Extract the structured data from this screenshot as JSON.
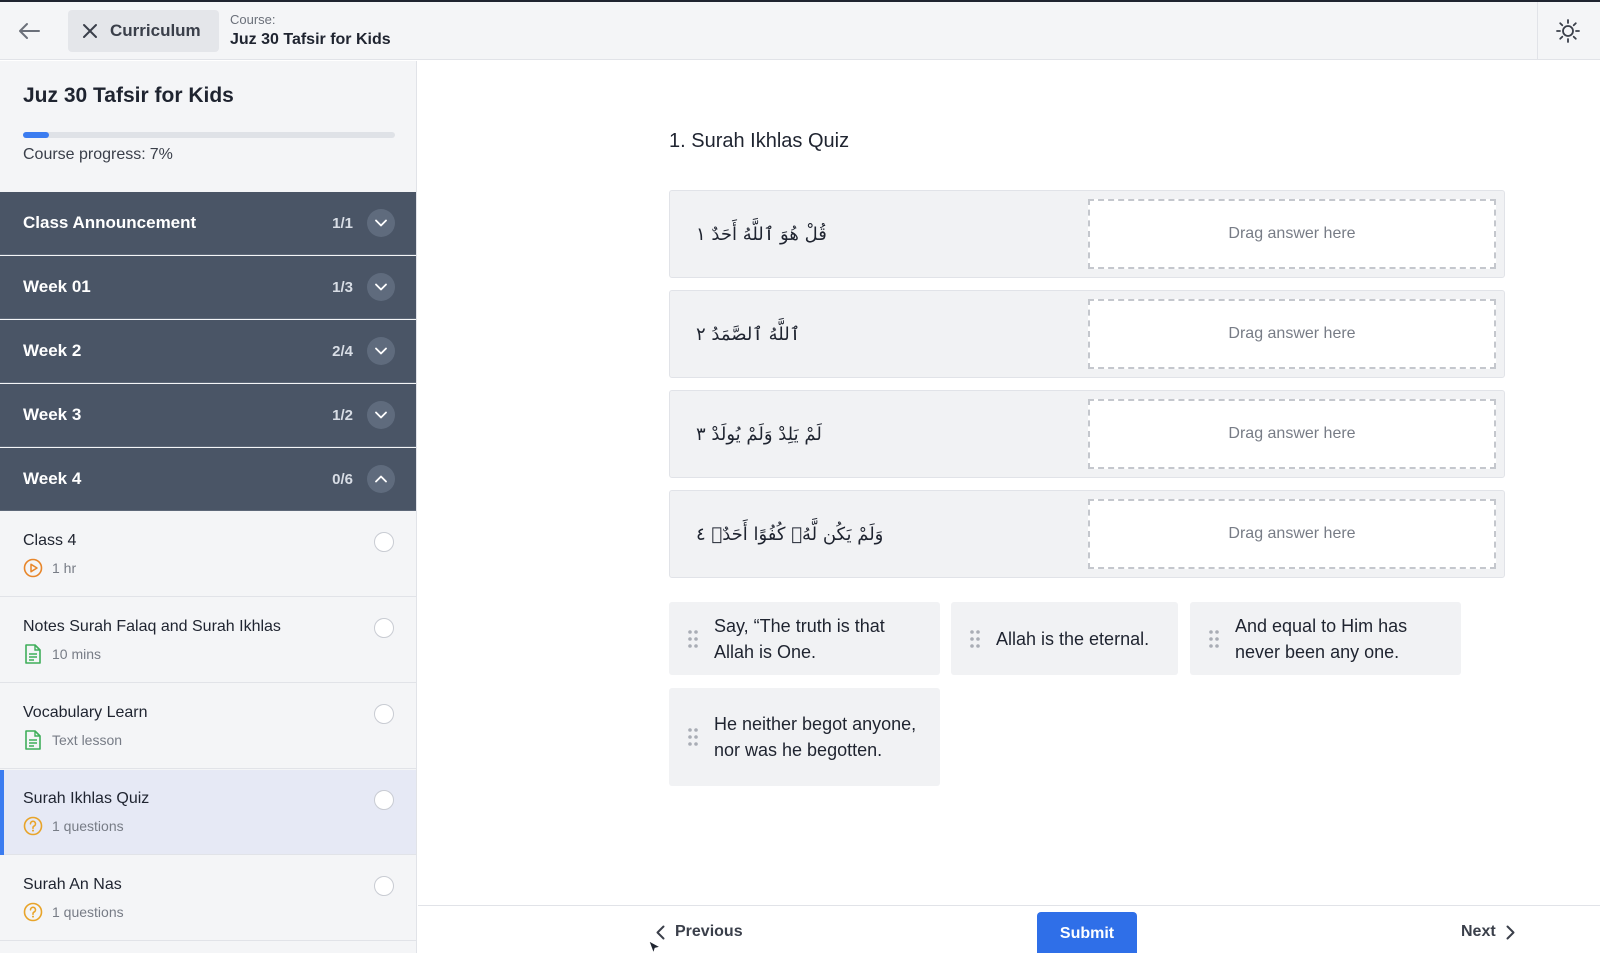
{
  "header": {
    "back_icon": "arrow-left-icon",
    "curriculum_label": "Curriculum",
    "course_label": "Course:",
    "course_name": "Juz 30 Tafsir for Kids",
    "theme_icon": "sun-icon"
  },
  "sidebar": {
    "title": "Juz 30 Tafsir for Kids",
    "progress_fraction": 0.07,
    "progress_label": "Course progress:",
    "progress_value": "7%",
    "sections": [
      {
        "title": "Class Announcement",
        "count": "1/1",
        "expanded": false
      },
      {
        "title": "Week 01",
        "count": "1/3",
        "expanded": false
      },
      {
        "title": "Week 2",
        "count": "2/4",
        "expanded": false
      },
      {
        "title": "Week 3",
        "count": "1/2",
        "expanded": false
      },
      {
        "title": "Week 4",
        "count": "0/6",
        "expanded": true
      }
    ],
    "lessons": [
      {
        "title": "Class 4",
        "meta": "1 hr",
        "icon": "video-icon",
        "active": false
      },
      {
        "title": "Notes Surah Falaq and Surah Ikhlas",
        "meta": "10 mins",
        "icon": "document-icon",
        "active": false
      },
      {
        "title": "Vocabulary Learn",
        "meta": "Text lesson",
        "icon": "document-icon",
        "active": false
      },
      {
        "title": "Surah Ikhlas Quiz",
        "meta": "1 questions",
        "icon": "question-icon",
        "active": true
      },
      {
        "title": "Surah An Nas",
        "meta": "1 questions",
        "icon": "question-icon",
        "active": false
      }
    ]
  },
  "quiz": {
    "title": "1. Surah Ikhlas Quiz",
    "drop_placeholder": "Drag answer here",
    "verses": [
      "قُلْ هُوَ ٱللَّهُ أَحَدٌ ١",
      "ٱللَّهُ ٱلصَّمَدُ ٢",
      "لَمْ يَلِدْ وَلَمْ يُولَدْ ٣",
      "وَلَمْ يَكُن لَّهُۥ كُفُوًا أَحَدٌۢ ٤"
    ],
    "answers": [
      "Say, “The truth is that Allah is One.",
      "Allah is the eternal.",
      "And equal to Him has never been any one.",
      "He neither begot anyone, nor was he begotten."
    ]
  },
  "footer": {
    "previous_label": "Previous",
    "submit_label": "Submit",
    "next_label": "Next"
  }
}
